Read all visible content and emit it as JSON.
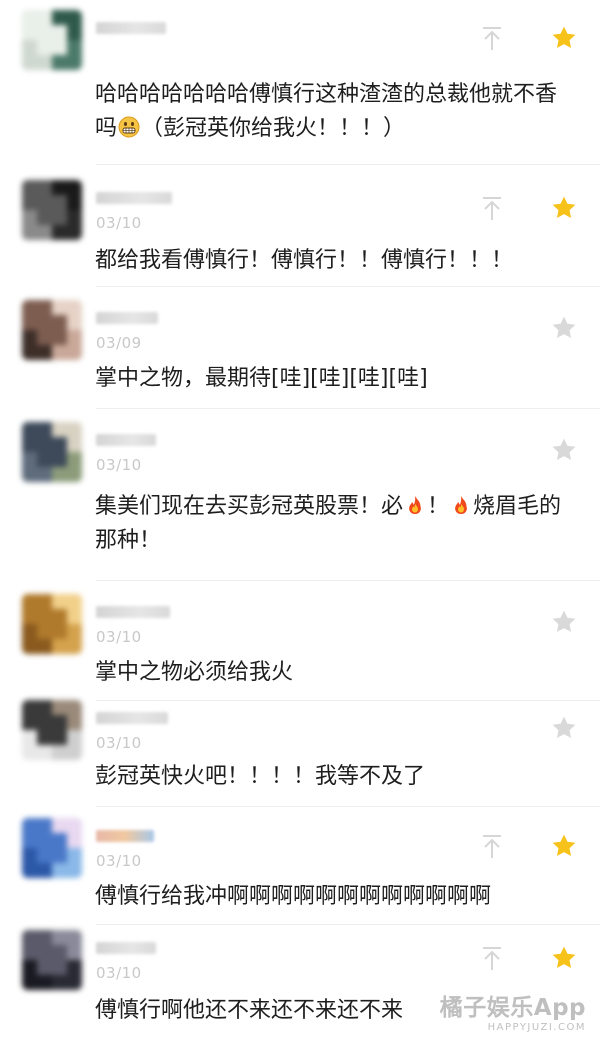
{
  "comments": [
    {
      "date": "",
      "text_html": "哈哈哈哈哈哈哈傅慎行这种渣渣的总裁他就不香吗<emoji:grin>（彭冠英你给我火！！！）",
      "starred": true,
      "show_arrow": true
    },
    {
      "date": "03/10",
      "text_html": "都给我看傅慎行！傅慎行！！傅慎行！！！",
      "starred": true,
      "show_arrow": true
    },
    {
      "date": "03/09",
      "text_html": "掌中之物，最期待[哇][哇][哇][哇]",
      "starred": false,
      "show_arrow": false
    },
    {
      "date": "03/10",
      "text_html": "集美们现在去买彭冠英股票！必<emoji:fire>！<emoji:fire>烧眉毛的那种！",
      "starred": false,
      "show_arrow": false
    },
    {
      "date": "03/10",
      "text_html": "掌中之物必须给我火",
      "starred": false,
      "show_arrow": false
    },
    {
      "date": "03/10",
      "text_html": "彭冠英快火吧！！！！我等不及了",
      "starred": false,
      "show_arrow": false
    },
    {
      "date": "03/10",
      "text_html": "傅慎行给我冲啊啊啊啊啊啊啊啊啊啊啊啊",
      "starred": true,
      "show_arrow": true
    },
    {
      "date": "03/10",
      "text_html": "傅慎行啊他还不来还不来还不来",
      "starred": true,
      "show_arrow": true
    }
  ],
  "watermark": {
    "main": "橘子娱乐App",
    "sub": "HAPPYJUZI.COM"
  },
  "colors": {
    "star_active": "#f7c21a",
    "star_inactive": "#d9d9d9",
    "arrow": "#d6d6d6"
  }
}
